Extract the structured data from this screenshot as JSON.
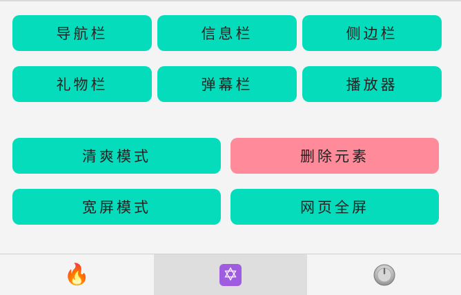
{
  "buttons": {
    "row1": {
      "nav": "导航栏",
      "info": "信息栏",
      "sidebar": "侧边栏"
    },
    "row2": {
      "gift": "礼物栏",
      "danmaku": "弹幕栏",
      "player": "播放器"
    },
    "row3": {
      "clean_mode": "清爽模式",
      "delete_element": "删除元素"
    },
    "row4": {
      "widescreen": "宽屏模式",
      "fullscreen_page": "网页全屏"
    }
  },
  "tabbar": {
    "tabs": [
      {
        "icon": "fire-icon",
        "glyph": "🔥",
        "active": false
      },
      {
        "icon": "star-of-david-icon",
        "glyph": "✡",
        "active": true
      },
      {
        "icon": "power-knob-icon",
        "glyph": "⏻",
        "active": false
      }
    ]
  },
  "colors": {
    "primary_button": "#05dcbc",
    "danger_button": "#ff8a99",
    "page_background": "#f4f4f4",
    "active_tab": "#dedede"
  }
}
